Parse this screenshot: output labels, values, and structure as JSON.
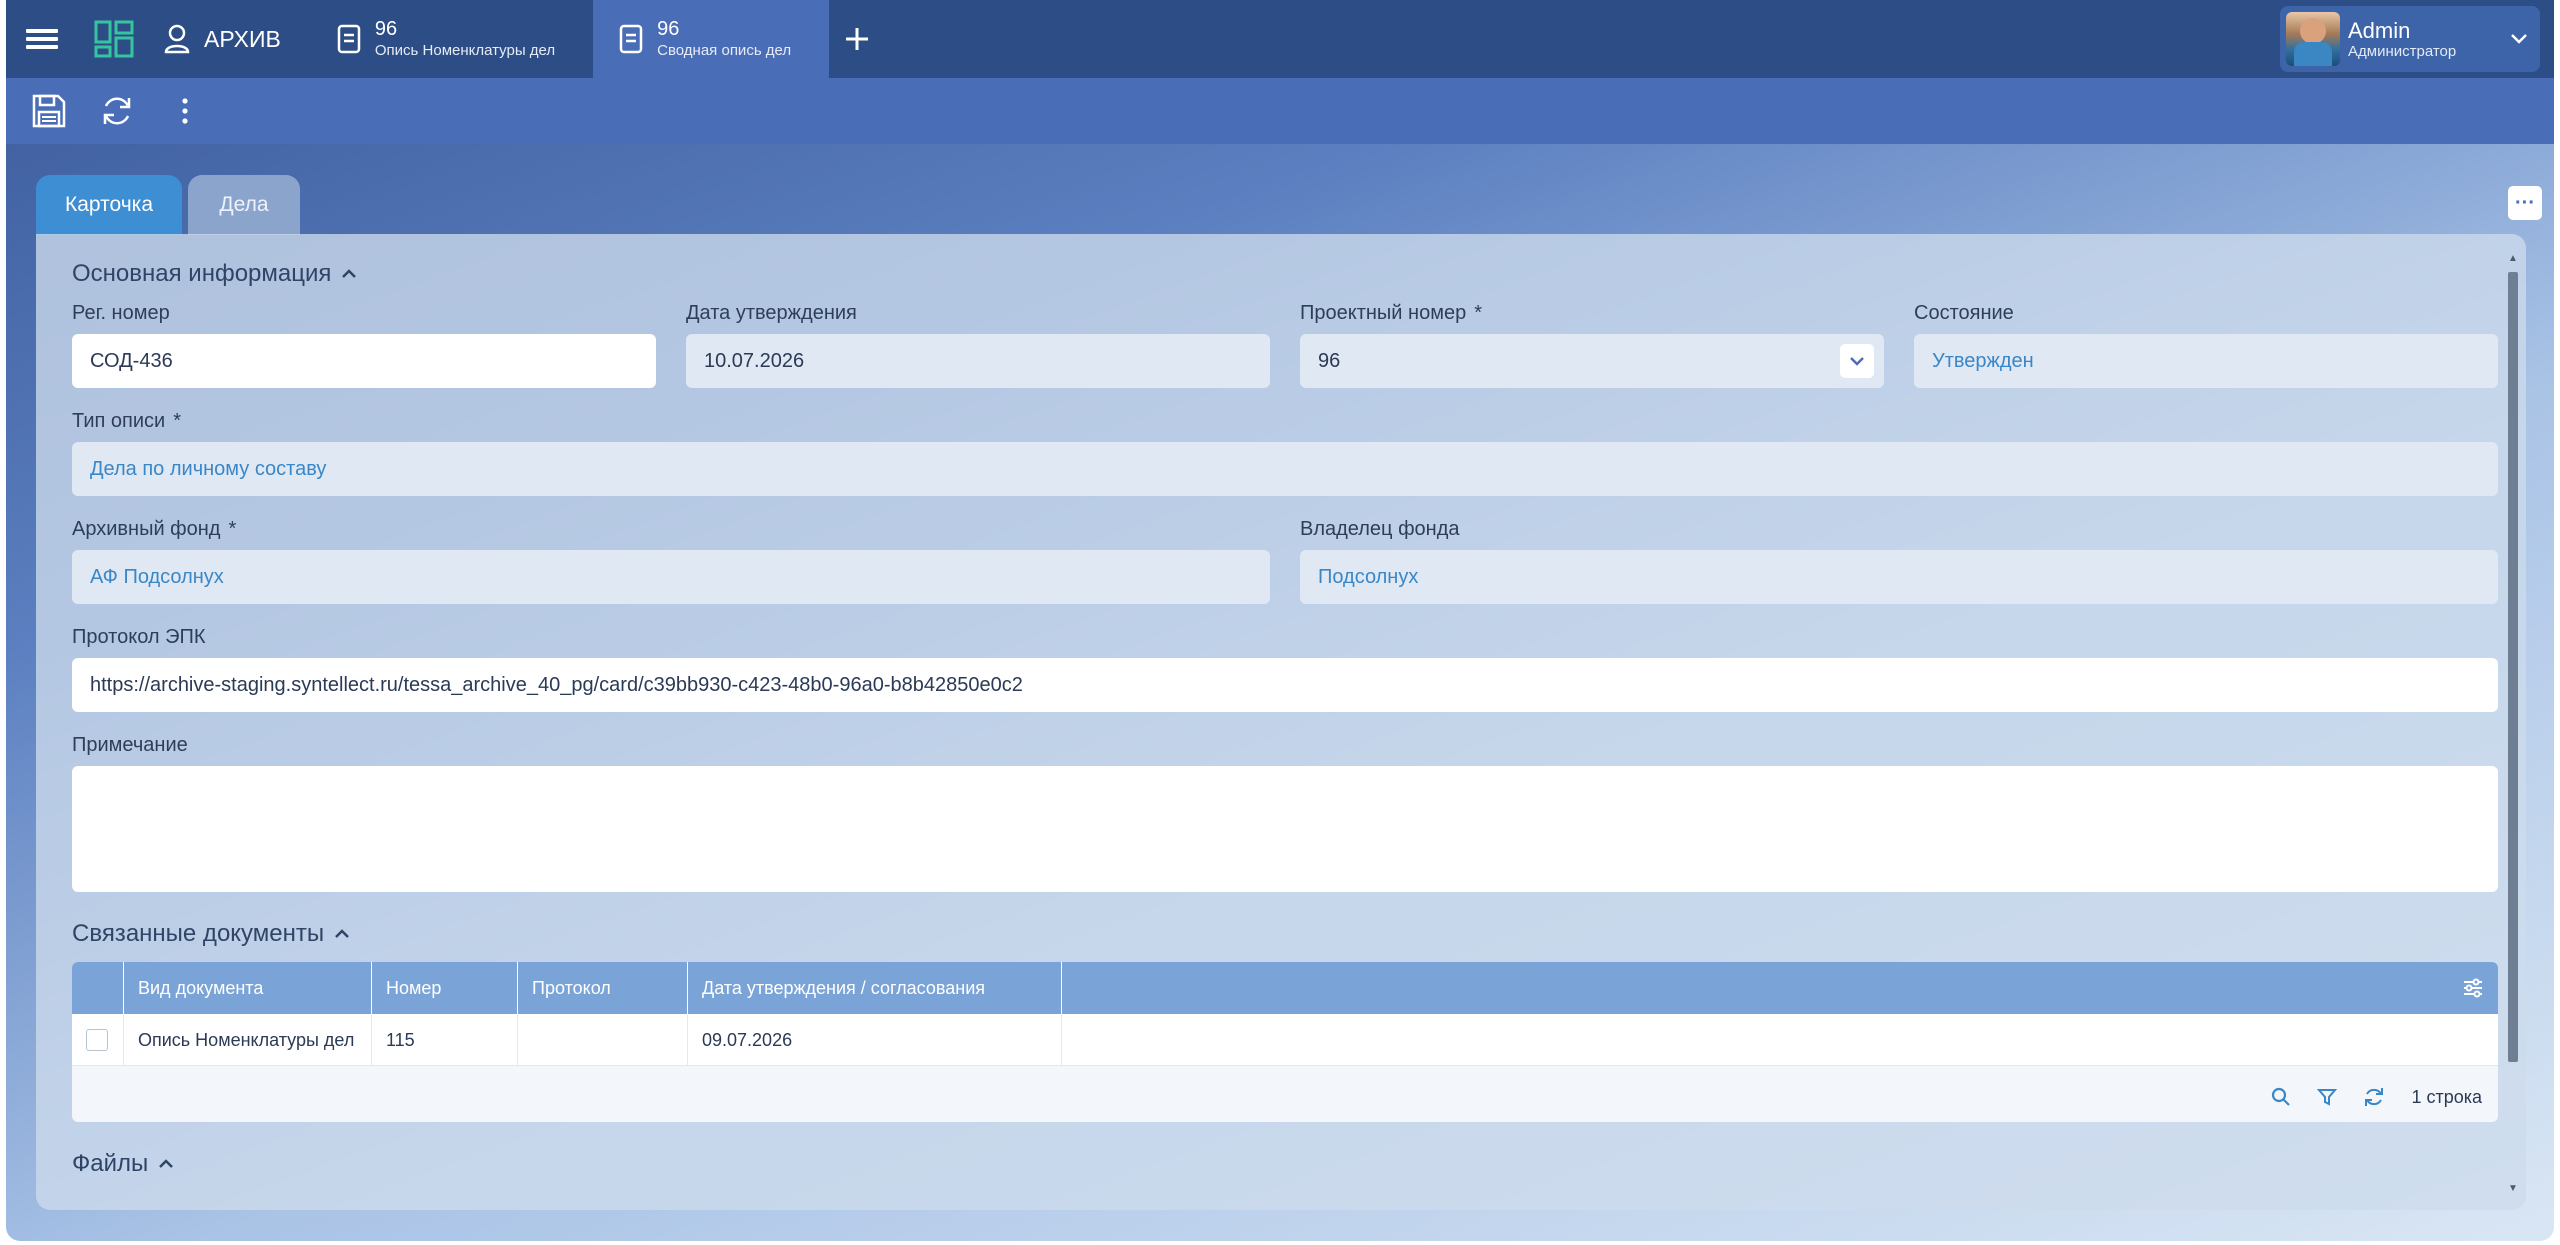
{
  "topbar": {
    "archive_label": "АРХИВ",
    "tabs": [
      {
        "number": "96",
        "subtitle": "Опись Номенклатуры дел"
      },
      {
        "number": "96",
        "subtitle": "Сводная опись дел"
      }
    ],
    "user": {
      "name": "Admin",
      "role": "Администратор"
    }
  },
  "tabs": {
    "card": "Карточка",
    "cases": "Дела"
  },
  "main_info": {
    "title": "Основная информация",
    "reg_number": {
      "label": "Рег. номер",
      "value": "СОД-436"
    },
    "approval_date": {
      "label": "Дата утверждения",
      "value": "10.07.2026"
    },
    "project_number": {
      "label": "Проектный номер",
      "required": "*",
      "value": "96"
    },
    "state": {
      "label": "Состояние",
      "value": "Утвержден"
    },
    "inventory_type": {
      "label": "Тип описи",
      "required": "*",
      "value": "Дела по личному составу"
    },
    "archive_fund": {
      "label": "Архивный фонд",
      "required": "*",
      "value": "АФ Подсолнух"
    },
    "fund_owner": {
      "label": "Владелец фонда",
      "value": "Подсолнух"
    },
    "epk_protocol": {
      "label": "Протокол ЭПК",
      "value": "https://archive-staging.syntellect.ru/tessa_archive_40_pg/card/c39bb930-c423-48b0-96a0-b8b42850e0c2"
    },
    "note": {
      "label": "Примечание",
      "value": ""
    }
  },
  "related_docs": {
    "title": "Связанные документы",
    "columns": [
      "Вид документа",
      "Номер",
      "Протокол",
      "Дата утверждения / согласования"
    ],
    "rows": [
      [
        "Опись Номенклатуры дел",
        "115",
        "",
        "09.07.2026"
      ]
    ],
    "row_count": "1 строка"
  },
  "files": {
    "title": "Файлы"
  },
  "colors": {
    "topbar": "#2d4d86",
    "toolbar": "#4a6db8",
    "accent": "#3d8ed3",
    "link": "#3a87c8",
    "grid_header": "#7aa4d7"
  }
}
